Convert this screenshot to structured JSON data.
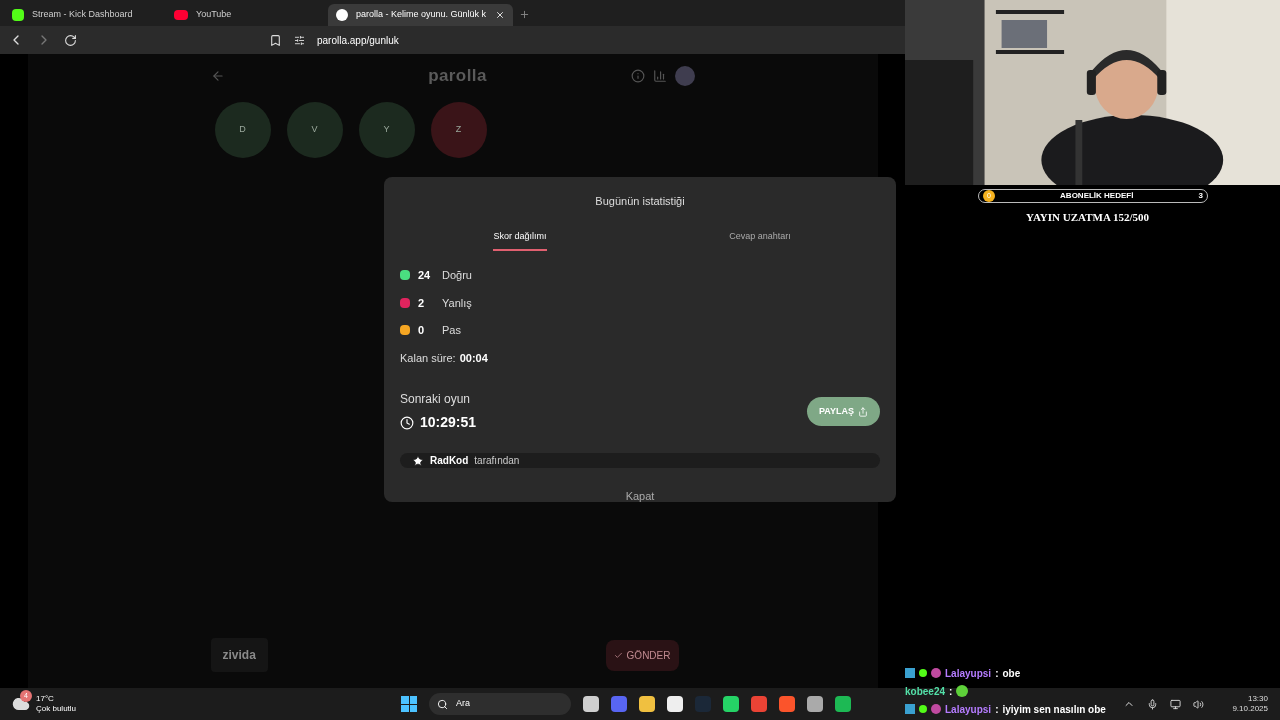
{
  "browser": {
    "tabs": [
      {
        "title": "Stream - Kick Dashboard",
        "selected": false,
        "kind": "kick"
      },
      {
        "title": "YouTube",
        "selected": false,
        "kind": "youtube"
      },
      {
        "title": "parolla - Kelime oyunu. Günlük k",
        "selected": true,
        "kind": "site"
      }
    ],
    "url": "parolla.app/gunluk"
  },
  "game": {
    "logo": "parolla",
    "letters": [
      {
        "letter": "D",
        "color": "#1c2a1f"
      },
      {
        "letter": "V",
        "color": "#1c2a1f"
      },
      {
        "letter": "Y",
        "color": "#1c2a1f"
      },
      {
        "letter": "Z",
        "color": "#3a1418"
      }
    ],
    "answer": "zivida",
    "send": "GÖNDER"
  },
  "modal": {
    "title": "Bugünün istatistiği",
    "tabs": [
      {
        "label": "Skor dağılımı",
        "selected": true
      },
      {
        "label": "Cevap anahtarı",
        "selected": false
      }
    ],
    "stats": [
      {
        "count": "24",
        "label": "Doğru",
        "color": "#4ade80"
      },
      {
        "count": "2",
        "label": "Yanlış",
        "color": "#e0245e"
      },
      {
        "count": "0",
        "label": "Pas",
        "color": "#f5a623"
      }
    ],
    "remaining_label": "Kalan süre:",
    "remaining": "00:04",
    "next_label": "Sonraki oyun",
    "next_time": "10:29:51",
    "share": "PAYLAŞ",
    "credit_name": "RadKod",
    "credit_text": "tarafından",
    "close": "Kapat"
  },
  "overlay": {
    "goal": {
      "current": "0",
      "label": "ABONELİK HEDEFİ",
      "target": "3"
    },
    "extension": "YAYIN UZATMA 152/500"
  },
  "chat": [
    {
      "user": "Lalayupsi",
      "separator": ":",
      "color": "#b57cff",
      "kind": "text",
      "message": "obe",
      "badges": true
    },
    {
      "user": "kobee24",
      "separator": ":",
      "color": "#53e0a8",
      "kind": "emote",
      "badges": false
    },
    {
      "user": "Lalayupsi",
      "separator": ":",
      "color": "#b57cff",
      "kind": "text",
      "message": "iyiyim sen nasılın obe",
      "badges": true
    }
  ],
  "taskbar": {
    "weather_badge": "4",
    "temperature": "17°C",
    "weather": "Çok bulutlu",
    "search": "Ara",
    "time": "13:30",
    "date": "9.10.2025"
  }
}
